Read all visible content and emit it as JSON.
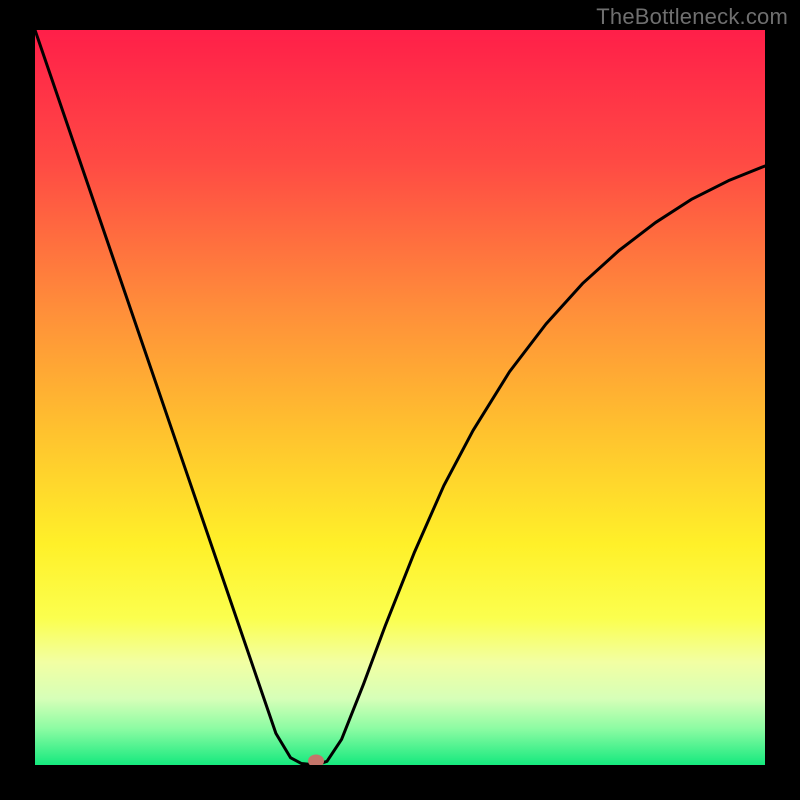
{
  "watermark": "TheBottleneck.com",
  "chart_data": {
    "type": "line",
    "title": "",
    "xlabel": "",
    "ylabel": "",
    "xlim": [
      0,
      100
    ],
    "ylim": [
      0,
      100
    ],
    "grid": false,
    "legend": false,
    "marker": {
      "x": 38.5,
      "y": 0,
      "color": "#c4756a"
    },
    "series": [
      {
        "name": "curve",
        "x": [
          0,
          5,
          10,
          15,
          20,
          25,
          30,
          33,
          35,
          36.5,
          38.5,
          40,
          42,
          45,
          48,
          52,
          56,
          60,
          65,
          70,
          75,
          80,
          85,
          90,
          95,
          100
        ],
        "y": [
          100,
          85.5,
          71,
          56.5,
          42,
          27.5,
          13,
          4.3,
          1.0,
          0.2,
          0,
          0.5,
          3.5,
          11,
          19,
          29,
          38,
          45.5,
          53.5,
          60,
          65.5,
          70,
          73.8,
          77,
          79.5,
          81.5
        ]
      }
    ],
    "background_gradient": {
      "stops": [
        {
          "pos": 0.0,
          "color": "#ff1f49"
        },
        {
          "pos": 0.18,
          "color": "#ff4a44"
        },
        {
          "pos": 0.38,
          "color": "#ff8e3a"
        },
        {
          "pos": 0.55,
          "color": "#ffc32e"
        },
        {
          "pos": 0.7,
          "color": "#fff029"
        },
        {
          "pos": 0.8,
          "color": "#fbff4e"
        },
        {
          "pos": 0.86,
          "color": "#f2ffa3"
        },
        {
          "pos": 0.91,
          "color": "#d6ffb8"
        },
        {
          "pos": 0.95,
          "color": "#8dfca3"
        },
        {
          "pos": 1.0,
          "color": "#15e97e"
        }
      ]
    }
  }
}
